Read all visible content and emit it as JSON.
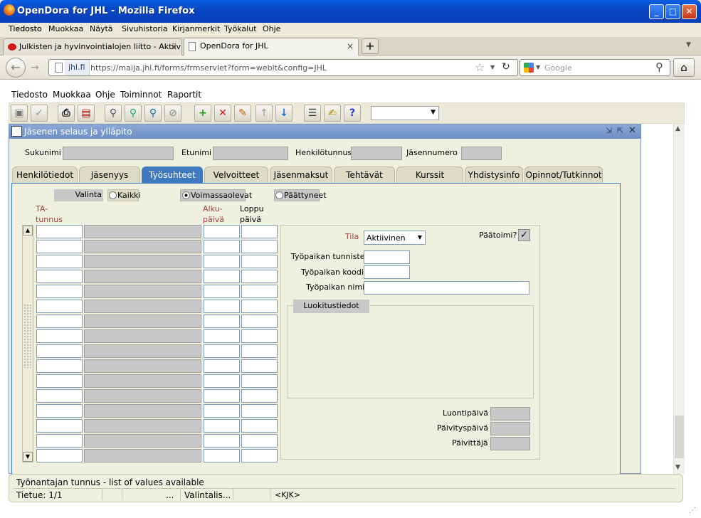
{
  "window": {
    "title": "OpenDora for JHL - Mozilla Firefox",
    "min": "_",
    "max": "□",
    "close": "✕"
  },
  "browser_menu": [
    "Tiedosto",
    "Muokkaa",
    "Näytä",
    "Sivuhistoria",
    "Kirjanmerkit",
    "Työkalut",
    "Ohje"
  ],
  "browser_tabs": [
    {
      "label": "Julkisten ja hyvinvointialojen liitto - Aktiivit",
      "close": "×"
    },
    {
      "label": "OpenDora for JHL",
      "close": "×"
    }
  ],
  "new_tab": "+",
  "nav": {
    "site": "jhl.fi",
    "url": "https://maija.jhl.fi/forms/frmservlet?form=weblt&config=JHL",
    "search_placeholder": "Google"
  },
  "app_menu": [
    "Tiedosto",
    "Muokkaa",
    "Ohje",
    "Toiminnot",
    "Raportit"
  ],
  "form": {
    "title": "Jäsenen selaus ja ylläpito",
    "header_fields": {
      "sukunimi": "Sukunimi",
      "etunimi": "Etunimi",
      "henkilotunnus": "Henkilötunnus",
      "jasennumero": "Jäsennumero"
    },
    "tabs": [
      "Henkilötiedot",
      "Jäsenyys",
      "Työsuhteet",
      "Velvoitteet",
      "Jäsenmaksut",
      "Tehtävät",
      "Kurssit",
      "Yhdistysinfo",
      "Opinnot/Tutkinnot"
    ],
    "active_tab": "Työsuhteet",
    "filter": {
      "valinta": "Valinta",
      "kaikki": "Kaikki",
      "voimassa": "Voimassaolevat",
      "paattyneet": "Päättyneet"
    },
    "columns": {
      "ta1": "TA-",
      "ta2": "tunnus",
      "alku1": "Alku-",
      "alku2": "päivä",
      "loppu1": "Loppu",
      "loppu2": "päivä"
    },
    "detail": {
      "tila_label": "Tila",
      "tila_value": "Aktiivinen",
      "paatoimi": "Päätoimi?",
      "paatoimi_check": "✓",
      "tunniste": "Työpaikan tunniste",
      "koodi": "Työpaikan koodi",
      "nimi": "Työpaikan nimi",
      "luokitus": "Luokitustiedot",
      "luontipaiva": "Luontipäivä",
      "paivityspaiva": "Päivityspäivä",
      "paivittaja": "Päivittäjä"
    }
  },
  "status": {
    "message": "Työnantajan tunnus - list of values available",
    "record": "Tietue: 1/1",
    "dots": "...",
    "lov": "Valintalis...",
    "kjk": "<KJK>"
  }
}
